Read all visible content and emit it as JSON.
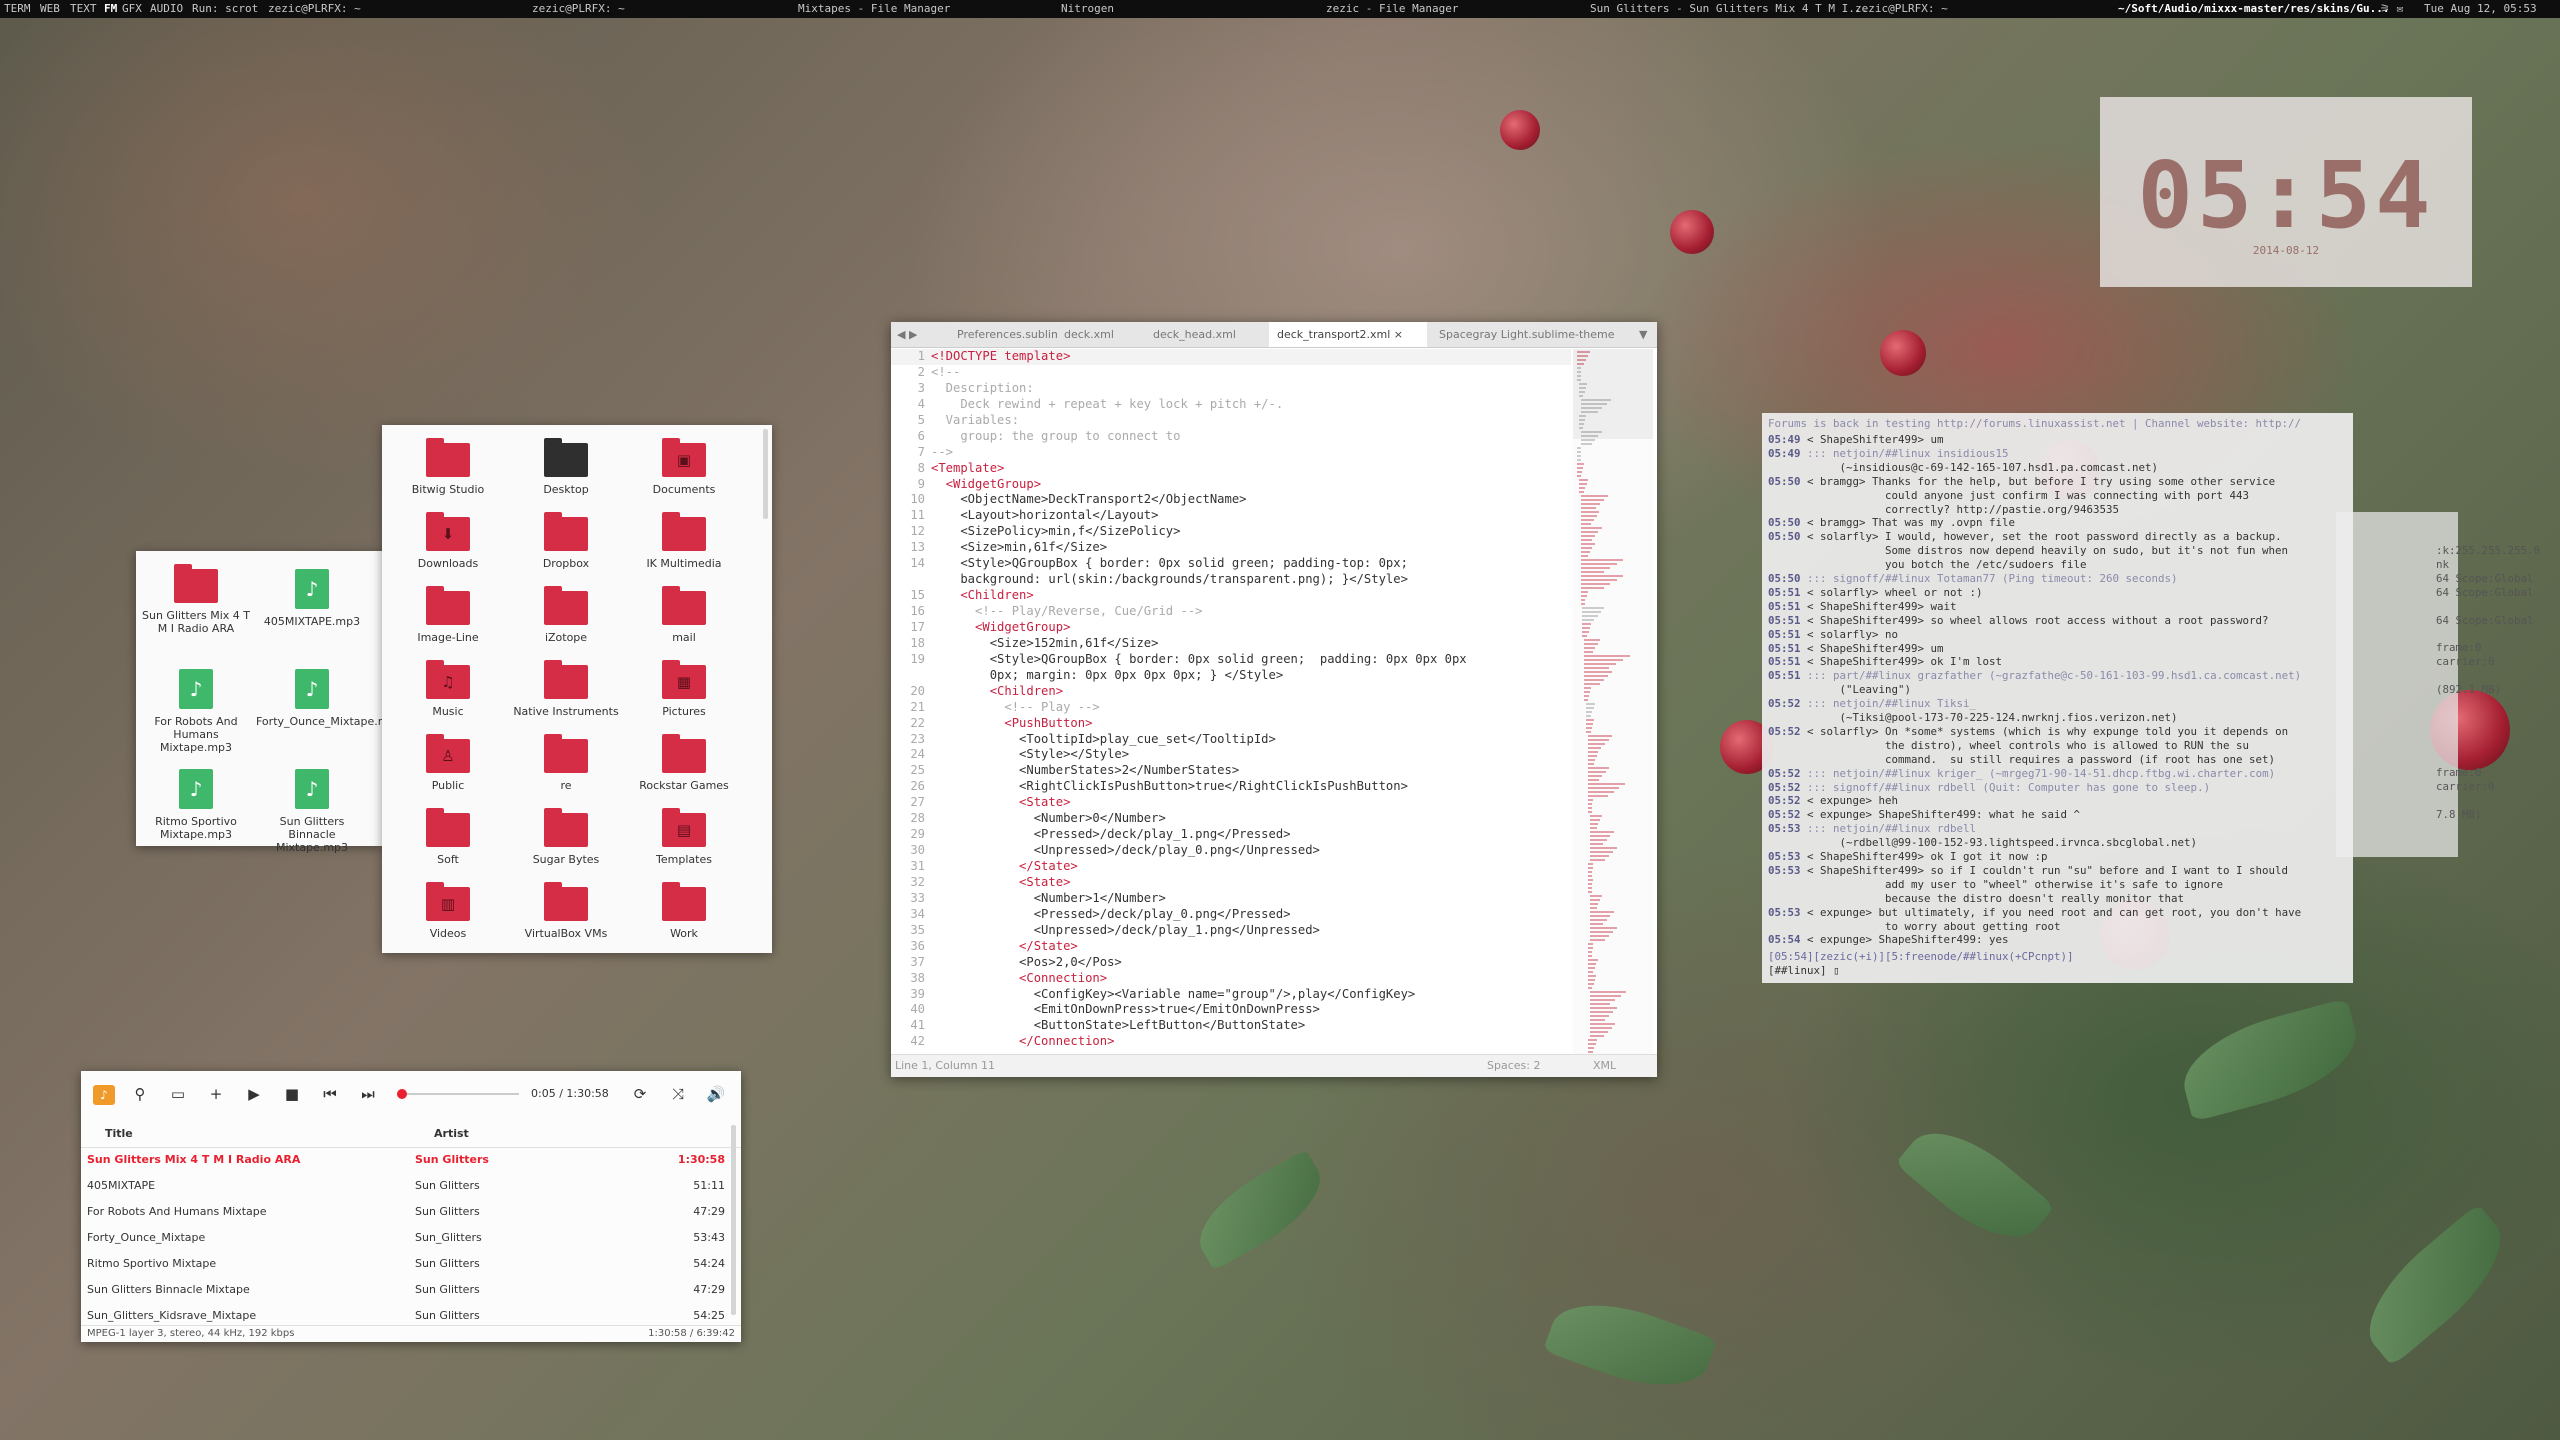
{
  "topbar": {
    "workspaces": [
      "TERM",
      "WEB",
      "TEXT",
      "FM",
      "GFX",
      "AUDIO"
    ],
    "active_workspace": "FM",
    "run_label": "Run: scrot",
    "windows": [
      "zezic@PLRFX: ~",
      "zezic@PLRFX: ~",
      "Mixtapes - File Manager",
      "Nitrogen",
      "zezic - File Manager",
      "Sun Glitters - Sun Glitters Mix 4 T M I...",
      "zezic@PLRFX: ~"
    ],
    "path": "~/Soft/Audio/mixxx-master/res/skins/Gu...",
    "datetime": "Tue Aug 12, 05:53"
  },
  "clock": {
    "time": "05:54",
    "date": "2014-08-12"
  },
  "mixtapes": {
    "items": [
      {
        "name": "Sun Glitters Mix 4 T M I Radio ARA",
        "type": "folder"
      },
      {
        "name": "405MIXTAPE.mp3",
        "type": "audio"
      },
      {
        "name": "For Robots And Humans Mixtape.mp3",
        "type": "audio"
      },
      {
        "name": "Forty_Ounce_Mixtape.mp3",
        "type": "audio"
      },
      {
        "name": "Ritmo Sportivo Mixtape.mp3",
        "type": "audio"
      },
      {
        "name": "Sun Glitters Binnacle Mixtape.mp3",
        "type": "audio"
      }
    ]
  },
  "home": {
    "items": [
      {
        "name": "Bitwig Studio",
        "glyph": ""
      },
      {
        "name": "Desktop",
        "glyph": "",
        "dark": true
      },
      {
        "name": "Documents",
        "glyph": "▣"
      },
      {
        "name": "Downloads",
        "glyph": "⬇"
      },
      {
        "name": "Dropbox",
        "glyph": ""
      },
      {
        "name": "IK Multimedia",
        "glyph": ""
      },
      {
        "name": "Image-Line",
        "glyph": ""
      },
      {
        "name": "iZotope",
        "glyph": ""
      },
      {
        "name": "mail",
        "glyph": ""
      },
      {
        "name": "Music",
        "glyph": "♫"
      },
      {
        "name": "Native Instruments",
        "glyph": ""
      },
      {
        "name": "Pictures",
        "glyph": "▦"
      },
      {
        "name": "Public",
        "glyph": "♙"
      },
      {
        "name": "re",
        "glyph": ""
      },
      {
        "name": "Rockstar Games",
        "glyph": ""
      },
      {
        "name": "Soft",
        "glyph": ""
      },
      {
        "name": "Sugar Bytes",
        "glyph": ""
      },
      {
        "name": "Templates",
        "glyph": "▤"
      },
      {
        "name": "Videos",
        "glyph": "▥"
      },
      {
        "name": "VirtualBox VMs",
        "glyph": ""
      },
      {
        "name": "Work",
        "glyph": ""
      }
    ]
  },
  "editor": {
    "tabs": [
      "Preferences.sublime",
      "deck.xml",
      "deck_head.xml",
      "deck_transport2.xml",
      "Spacegray Light.sublime-theme"
    ],
    "active_tab": 3,
    "status_left": "Line 1, Column 11",
    "status_spaces": "Spaces: 2",
    "status_syntax": "XML",
    "lines": [
      {
        "n": "1",
        "t": "<!DOCTYPE template>",
        "k": "t"
      },
      {
        "n": "2",
        "t": "<!--",
        "k": "c"
      },
      {
        "n": "3",
        "t": "  Description:",
        "k": "c"
      },
      {
        "n": "4",
        "t": "    Deck rewind + repeat + key lock + pitch +/-.",
        "k": "c"
      },
      {
        "n": "5",
        "t": "  Variables:",
        "k": "c"
      },
      {
        "n": "6",
        "t": "    group: the group to connect to",
        "k": "c"
      },
      {
        "n": "7",
        "t": "-->",
        "k": "c"
      },
      {
        "n": "8",
        "t": "<Template>",
        "k": "t"
      },
      {
        "n": "9",
        "t": "  <WidgetGroup>",
        "k": "t"
      },
      {
        "n": "10",
        "t": "    <ObjectName>DeckTransport2</ObjectName>",
        "k": "m"
      },
      {
        "n": "11",
        "t": "    <Layout>horizontal</Layout>",
        "k": "m"
      },
      {
        "n": "12",
        "t": "    <SizePolicy>min,f</SizePolicy>",
        "k": "m"
      },
      {
        "n": "13",
        "t": "    <Size>min,61f</Size>",
        "k": "m"
      },
      {
        "n": "14",
        "t": "    <Style>QGroupBox { border: 0px solid green; padding-top: 0px;",
        "k": "m"
      },
      {
        "n": "",
        "t": "    background: url(skin:/backgrounds/transparent.png); }</Style>",
        "k": "m"
      },
      {
        "n": "15",
        "t": "    <Children>",
        "k": "t"
      },
      {
        "n": "16",
        "t": "      <!-- Play/Reverse, Cue/Grid -->",
        "k": "c"
      },
      {
        "n": "17",
        "t": "      <WidgetGroup>",
        "k": "t"
      },
      {
        "n": "18",
        "t": "        <Size>152min,61f</Size>",
        "k": "m"
      },
      {
        "n": "19",
        "t": "        <Style>QGroupBox { border: 0px solid green;  padding: 0px 0px 0px",
        "k": "m"
      },
      {
        "n": "",
        "t": "        0px; margin: 0px 0px 0px 0px; } </Style>",
        "k": "m"
      },
      {
        "n": "20",
        "t": "        <Children>",
        "k": "t"
      },
      {
        "n": "21",
        "t": "          <!-- Play -->",
        "k": "c"
      },
      {
        "n": "22",
        "t": "          <PushButton>",
        "k": "t"
      },
      {
        "n": "23",
        "t": "            <TooltipId>play_cue_set</TooltipId>",
        "k": "m"
      },
      {
        "n": "24",
        "t": "            <Style></Style>",
        "k": "m"
      },
      {
        "n": "25",
        "t": "            <NumberStates>2</NumberStates>",
        "k": "m"
      },
      {
        "n": "26",
        "t": "            <RightClickIsPushButton>true</RightClickIsPushButton>",
        "k": "m"
      },
      {
        "n": "27",
        "t": "            <State>",
        "k": "t"
      },
      {
        "n": "28",
        "t": "              <Number>0</Number>",
        "k": "m"
      },
      {
        "n": "29",
        "t": "              <Pressed>/deck/play_1.png</Pressed>",
        "k": "m"
      },
      {
        "n": "30",
        "t": "              <Unpressed>/deck/play_0.png</Unpressed>",
        "k": "m"
      },
      {
        "n": "31",
        "t": "            </State>",
        "k": "t"
      },
      {
        "n": "32",
        "t": "            <State>",
        "k": "t"
      },
      {
        "n": "33",
        "t": "              <Number>1</Number>",
        "k": "m"
      },
      {
        "n": "34",
        "t": "              <Pressed>/deck/play_0.png</Pressed>",
        "k": "m"
      },
      {
        "n": "35",
        "t": "              <Unpressed>/deck/play_1.png</Unpressed>",
        "k": "m"
      },
      {
        "n": "36",
        "t": "            </State>",
        "k": "t"
      },
      {
        "n": "37",
        "t": "            <Pos>2,0</Pos>",
        "k": "m"
      },
      {
        "n": "38",
        "t": "            <Connection>",
        "k": "t"
      },
      {
        "n": "39",
        "t": "              <ConfigKey><Variable name=\"group\"/>,play</ConfigKey>",
        "k": "m"
      },
      {
        "n": "40",
        "t": "              <EmitOnDownPress>true</EmitOnDownPress>",
        "k": "m"
      },
      {
        "n": "41",
        "t": "              <ButtonState>LeftButton</ButtonState>",
        "k": "m"
      },
      {
        "n": "42",
        "t": "            </Connection>",
        "k": "t"
      }
    ]
  },
  "irc": {
    "topic": "Forums is back in testing http://forums.linuxassist.net | Channel website: http://",
    "lines": [
      {
        "ts": "05:49",
        "nick": "< ShapeShifter499>",
        "msg": " um"
      },
      {
        "ts": "05:49",
        "nick": ":::",
        "msg": " netjoin/##linux insidious15"
      },
      {
        "ts": "",
        "nick": "",
        "msg": "           (~insidious@c-69-142-165-107.hsd1.pa.comcast.net)"
      },
      {
        "ts": "05:50",
        "nick": "< bramgg>",
        "msg": " Thanks for the help, but before I try using some other service"
      },
      {
        "ts": "",
        "nick": "",
        "msg": "                  could anyone just confirm I was connecting with port 443"
      },
      {
        "ts": "",
        "nick": "",
        "msg": "                  correctly? http://pastie.org/9463535"
      },
      {
        "ts": "05:50",
        "nick": "< bramgg>",
        "msg": " That was my .ovpn file"
      },
      {
        "ts": "05:50",
        "nick": "< solarfly>",
        "msg": " I would, however, set the root password directly as a backup."
      },
      {
        "ts": "",
        "nick": "",
        "msg": "                  Some distros now depend heavily on sudo, but it's not fun when"
      },
      {
        "ts": "",
        "nick": "",
        "msg": "                  you botch the /etc/sudoers file"
      },
      {
        "ts": "05:50",
        "nick": ":::",
        "msg": " signoff/##linux Totaman77 (Ping timeout: 260 seconds)"
      },
      {
        "ts": "05:51",
        "nick": "< solarfly>",
        "msg": " wheel or not :)"
      },
      {
        "ts": "05:51",
        "nick": "< ShapeShifter499>",
        "msg": " wait"
      },
      {
        "ts": "05:51",
        "nick": "< ShapeShifter499>",
        "msg": " so wheel allows root access without a root password?"
      },
      {
        "ts": "05:51",
        "nick": "< solarfly>",
        "msg": " no"
      },
      {
        "ts": "05:51",
        "nick": "< ShapeShifter499>",
        "msg": " um"
      },
      {
        "ts": "05:51",
        "nick": "< ShapeShifter499>",
        "msg": " ok I'm lost"
      },
      {
        "ts": "05:51",
        "nick": ":::",
        "msg": " part/##linux grazfather (~grazfathe@c-50-161-103-99.hsd1.ca.comcast.net)"
      },
      {
        "ts": "",
        "nick": "",
        "msg": "           (\"Leaving\")"
      },
      {
        "ts": "05:52",
        "nick": ":::",
        "msg": " netjoin/##linux Tiksi_"
      },
      {
        "ts": "",
        "nick": "",
        "msg": "           (~Tiksi@pool-173-70-225-124.nwrknj.fios.verizon.net)"
      },
      {
        "ts": "05:52",
        "nick": "< solarfly>",
        "msg": " On *some* systems (which is why expunge told you it depends on"
      },
      {
        "ts": "",
        "nick": "",
        "msg": "                  the distro), wheel controls who is allowed to RUN the su"
      },
      {
        "ts": "",
        "nick": "",
        "msg": "                  command.  su still requires a password (if root has one set)"
      },
      {
        "ts": "05:52",
        "nick": ":::",
        "msg": " netjoin/##linux kriger_ (~mrgeg71-90-14-51.dhcp.ftbg.wi.charter.com)"
      },
      {
        "ts": "05:52",
        "nick": ":::",
        "msg": " signoff/##linux rdbell (Quit: Computer has gone to sleep.)"
      },
      {
        "ts": "05:52",
        "nick": "< expunge>",
        "msg": " heh"
      },
      {
        "ts": "05:52",
        "nick": "< expunge>",
        "msg": " ShapeShifter499: what he said ^"
      },
      {
        "ts": "05:53",
        "nick": ":::",
        "msg": " netjoin/##linux rdbell"
      },
      {
        "ts": "",
        "nick": "",
        "msg": "           (~rdbell@99-100-152-93.lightspeed.irvnca.sbcglobal.net)"
      },
      {
        "ts": "05:53",
        "nick": "< ShapeShifter499>",
        "msg": " ok I got it now :p"
      },
      {
        "ts": "05:53",
        "nick": "< ShapeShifter499>",
        "msg": " so if I couldn't run \"su\" before and I want to I should"
      },
      {
        "ts": "",
        "nick": "",
        "msg": "                  add my user to \"wheel\" otherwise it's safe to ignore"
      },
      {
        "ts": "",
        "nick": "",
        "msg": "                  because the distro doesn't really monitor that"
      },
      {
        "ts": "05:53",
        "nick": "< expunge>",
        "msg": " but ultimately, if you need root and can get root, you don't have"
      },
      {
        "ts": "",
        "nick": "",
        "msg": "                  to worry about getting root"
      },
      {
        "ts": "05:54",
        "nick": "< expunge>",
        "msg": " ShapeShifter499: yes"
      }
    ],
    "statusline": "[05:54][zezic(+i)][5:freenode/##linux(+CPcnpt)]",
    "prompt": "[##linux] ",
    "bg_lines": [
      ":k:255.255.255.0",
      "nk",
      "64 Scope:Global",
      "64 Scope:Global",
      "",
      "64 Scope:Global",
      "",
      "frame:0",
      "carrier:0",
      "",
      "(892.1 MB)",
      "",
      "",
      "",
      "",
      "",
      "frame:0",
      "carrier:0",
      "",
      "7.8 MB)"
    ]
  },
  "player": {
    "time": "0:05 / 1:30:58",
    "progress": 0.001,
    "col_title": "Title",
    "col_artist": "Artist",
    "tracks": [
      {
        "title": "Sun Glitters Mix 4 T M I Radio ARA",
        "artist": "Sun Glitters",
        "length": "1:30:58",
        "playing": true
      },
      {
        "title": "405MIXTAPE",
        "artist": "Sun Glitters",
        "length": "51:11"
      },
      {
        "title": "For Robots And Humans Mixtape",
        "artist": "Sun Glitters",
        "length": "47:29"
      },
      {
        "title": "Forty_Ounce_Mixtape",
        "artist": "Sun_Glitters",
        "length": "53:43"
      },
      {
        "title": "Ritmo Sportivo Mixtape",
        "artist": "Sun Glitters",
        "length": "54:24"
      },
      {
        "title": "Sun Glitters Binnacle Mixtape",
        "artist": "Sun Glitters",
        "length": "47:29"
      },
      {
        "title": "Sun_Glitters_Kidsrave_Mixtape",
        "artist": "Sun Glitters",
        "length": "54:25"
      }
    ],
    "status_left": "MPEG-1 layer 3, stereo, 44 kHz, 192 kbps",
    "status_right": "1:30:58 / 6:39:42",
    "accent": "#e8202f"
  }
}
